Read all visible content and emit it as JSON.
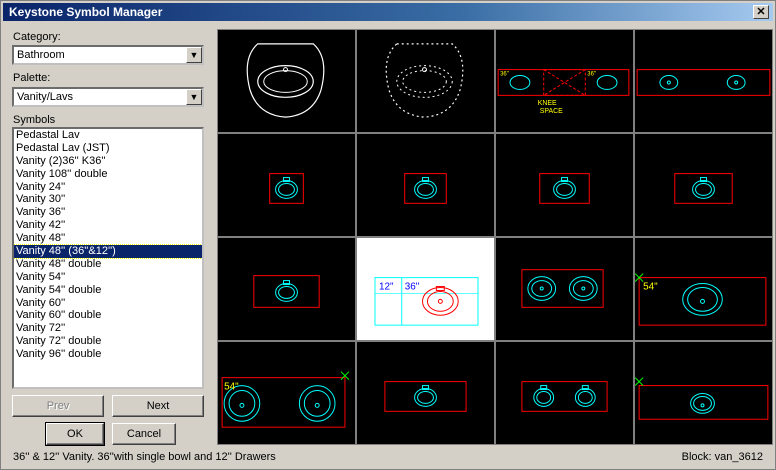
{
  "window": {
    "title": "Keystone Symbol Manager",
    "close_glyph": "✕"
  },
  "category": {
    "label": "Category:",
    "value": "Bathroom"
  },
  "palette": {
    "label": "Palette:",
    "value": "Vanity/Lavs"
  },
  "symbols": {
    "label": "Symbols",
    "items": [
      "Pedastal Lav",
      "Pedastal Lav (JST)",
      "Vanity (2)36'' K36''",
      "Vanity 108'' double",
      "Vanity 24''",
      "Vanity 30''",
      "Vanity 36''",
      "Vanity 42''",
      "Vanity 48''",
      "Vanity 48'' (36''&12'')",
      "Vanity 48'' double",
      "Vanity 54''",
      "Vanity 54'' double",
      "Vanity 60''",
      "Vanity 60'' double",
      "Vanity 72''",
      "Vanity 72'' double",
      "Vanity 96'' double"
    ],
    "selected_index": 9
  },
  "buttons": {
    "prev": "Prev",
    "next": "Next",
    "ok": "OK",
    "cancel": "Cancel"
  },
  "preview_texts": {
    "knee_space": "KNEE",
    "knee_space2": "SPACE",
    "label_36_small": "36\"",
    "label_12": "12\"",
    "label_36": "36\"",
    "label_54a": "54\"",
    "label_54b": "54\""
  },
  "status": {
    "description": "36'' & 12'' Vanity. 36''with single bowl and 12'' Drawers",
    "block": "Block:  van_3612"
  },
  "colors": {
    "cyan": "#00ffff",
    "red": "#ff0000",
    "white": "#ffffff",
    "yellow": "#ffff00",
    "green": "#00ff00",
    "selected": "#0a246a"
  }
}
